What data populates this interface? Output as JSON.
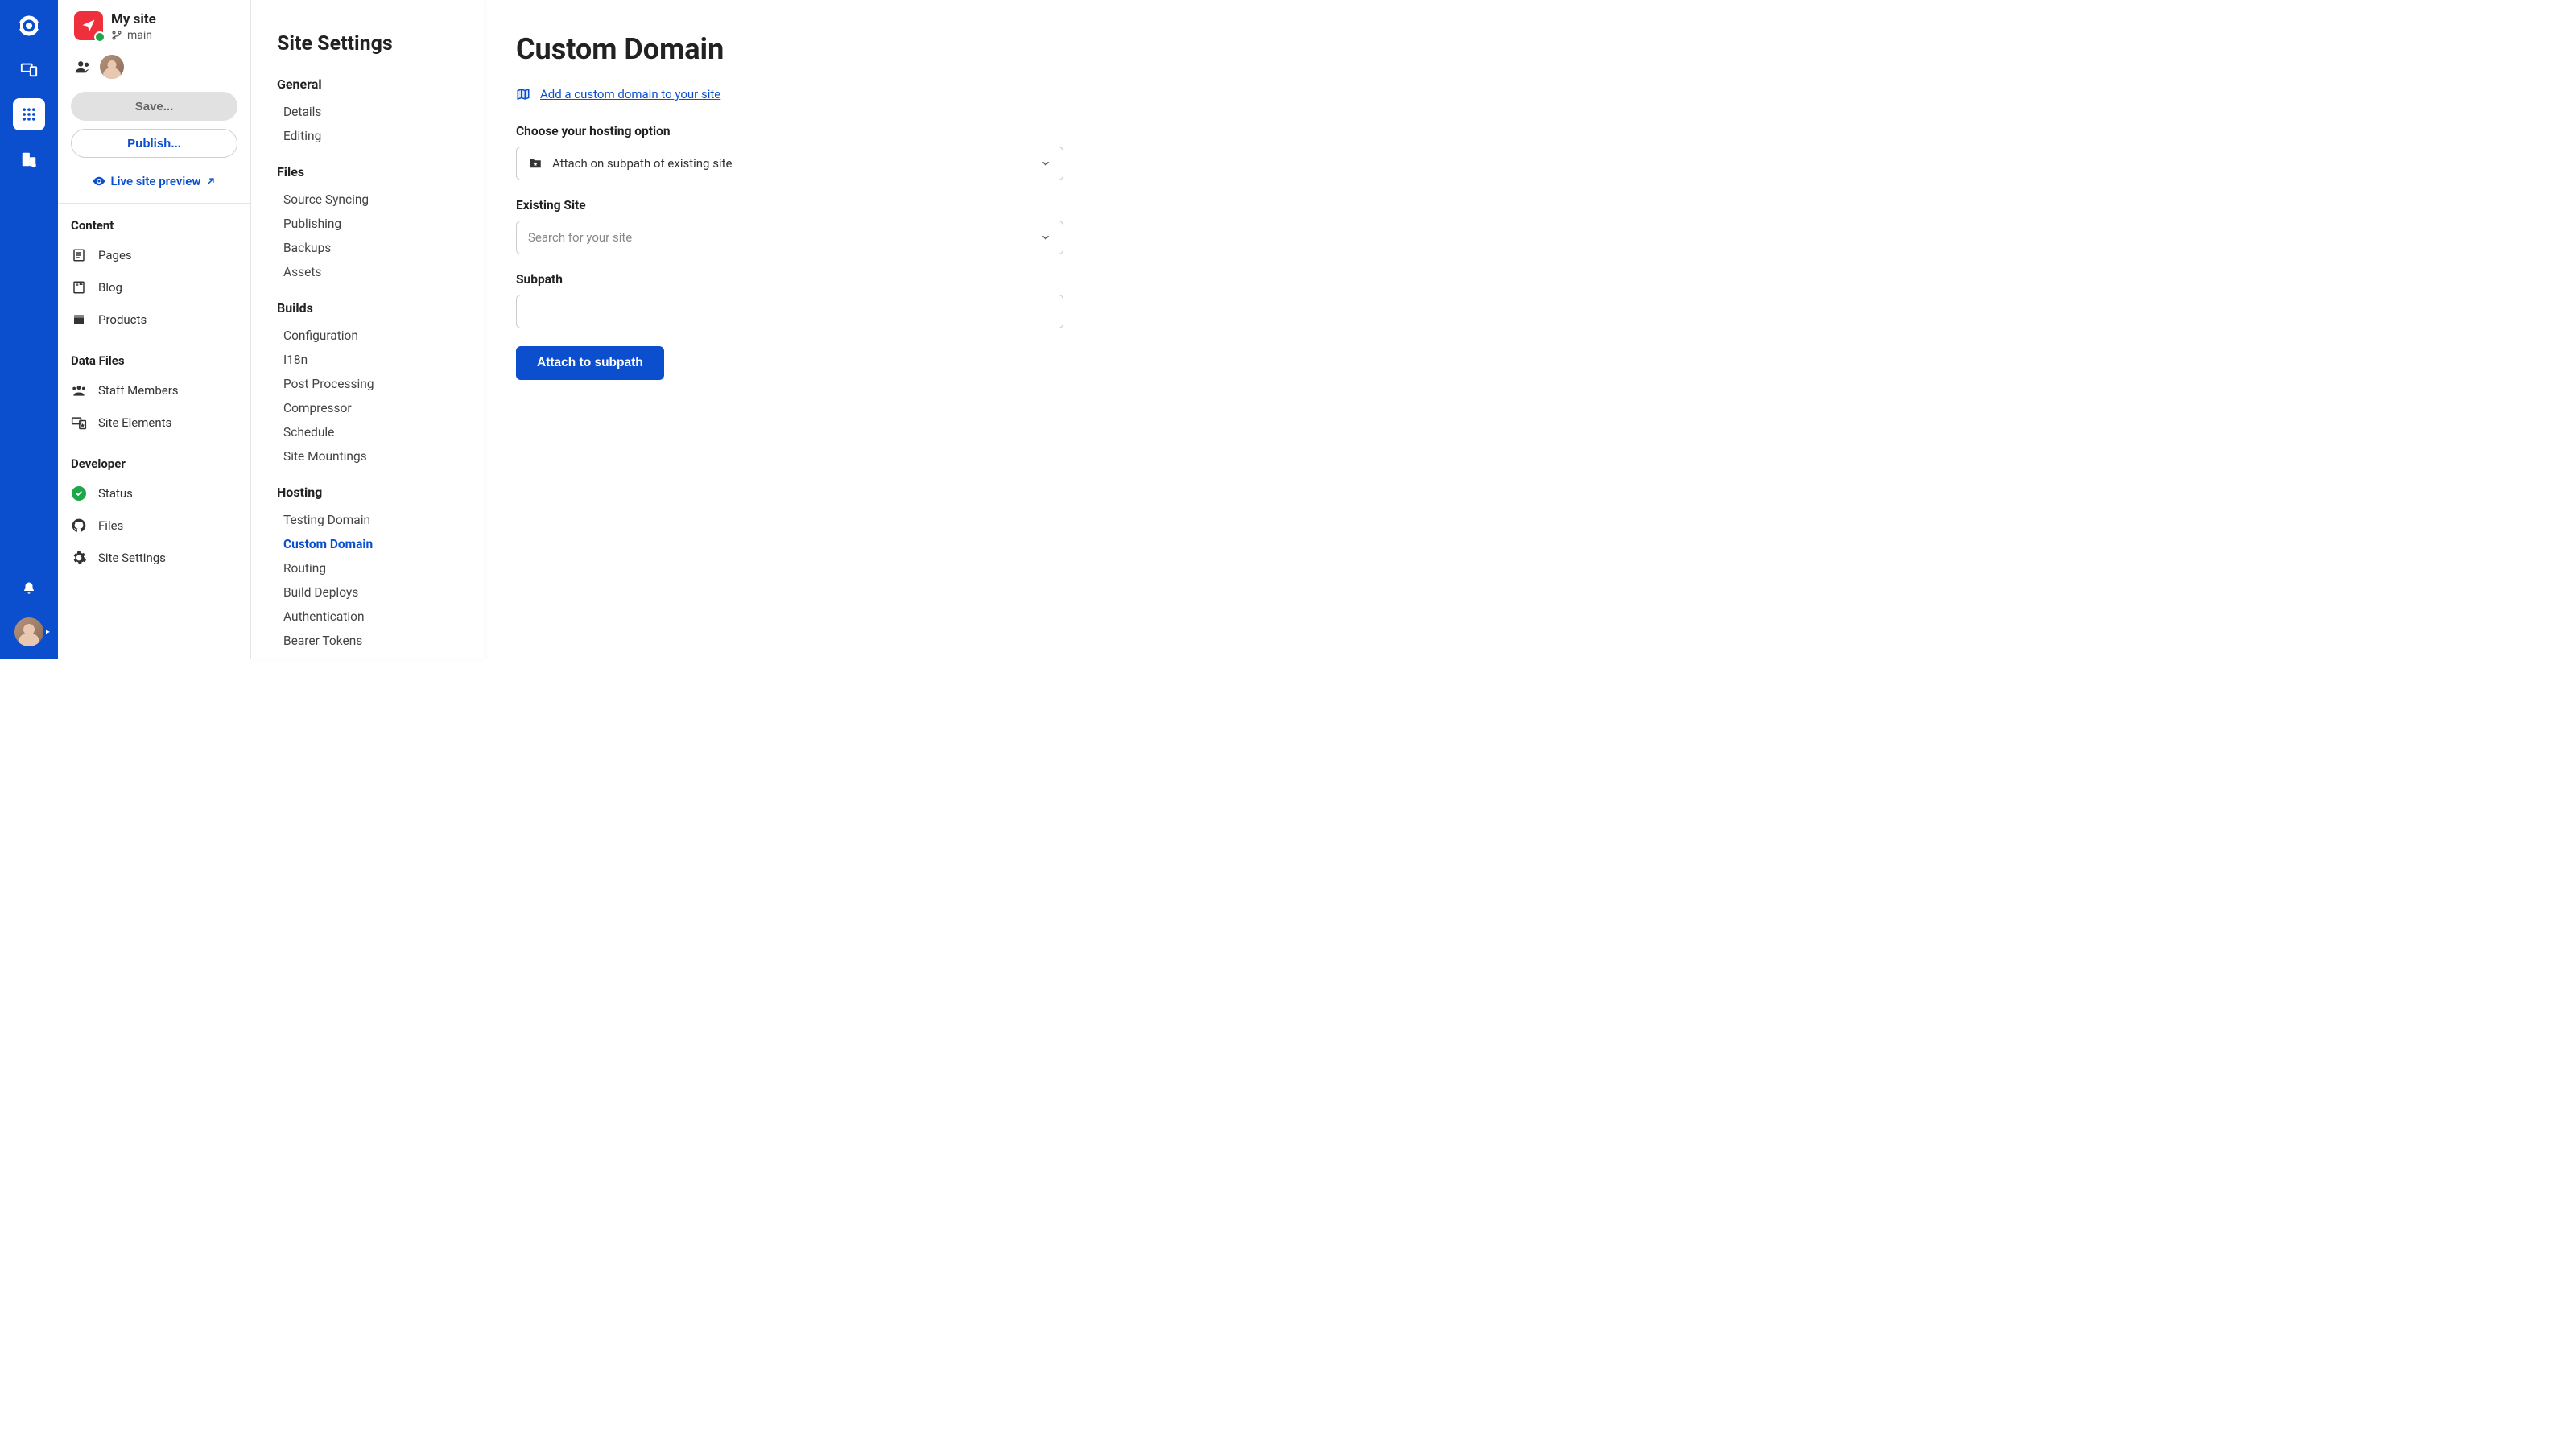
{
  "rail": {
    "icons": [
      "logo",
      "devices",
      "apps",
      "org"
    ],
    "bottom_icons": [
      "bell",
      "avatar"
    ]
  },
  "site": {
    "name": "My site",
    "branch": "main"
  },
  "sidebar": {
    "save_label": "Save...",
    "publish_label": "Publish...",
    "preview_label": "Live site preview",
    "sections": [
      {
        "title": "Content",
        "items": [
          {
            "icon": "page",
            "label": "Pages"
          },
          {
            "icon": "blog",
            "label": "Blog"
          },
          {
            "icon": "box",
            "label": "Products"
          }
        ]
      },
      {
        "title": "Data Files",
        "items": [
          {
            "icon": "people",
            "label": "Staff Members"
          },
          {
            "icon": "devices",
            "label": "Site Elements"
          }
        ]
      },
      {
        "title": "Developer",
        "items": [
          {
            "icon": "status",
            "label": "Status"
          },
          {
            "icon": "github",
            "label": "Files"
          },
          {
            "icon": "gear",
            "label": "Site Settings"
          }
        ]
      }
    ]
  },
  "settings": {
    "title": "Site Settings",
    "groups": [
      {
        "title": "General",
        "items": [
          "Details",
          "Editing"
        ]
      },
      {
        "title": "Files",
        "items": [
          "Source Syncing",
          "Publishing",
          "Backups",
          "Assets"
        ]
      },
      {
        "title": "Builds",
        "items": [
          "Configuration",
          "I18n",
          "Post Processing",
          "Compressor",
          "Schedule",
          "Site Mountings"
        ]
      },
      {
        "title": "Hosting",
        "items": [
          "Testing Domain",
          "Custom Domain",
          "Routing",
          "Build Deploys",
          "Authentication",
          "Bearer Tokens"
        ]
      }
    ],
    "active": "Custom Domain"
  },
  "main": {
    "title": "Custom Domain",
    "docs_link": "Add a custom domain to your site",
    "hosting_label": "Choose your hosting option",
    "hosting_value": "Attach on subpath of existing site",
    "existing_label": "Existing Site",
    "existing_placeholder": "Search for your site",
    "subpath_label": "Subpath",
    "subpath_value": "",
    "submit_label": "Attach to subpath"
  }
}
